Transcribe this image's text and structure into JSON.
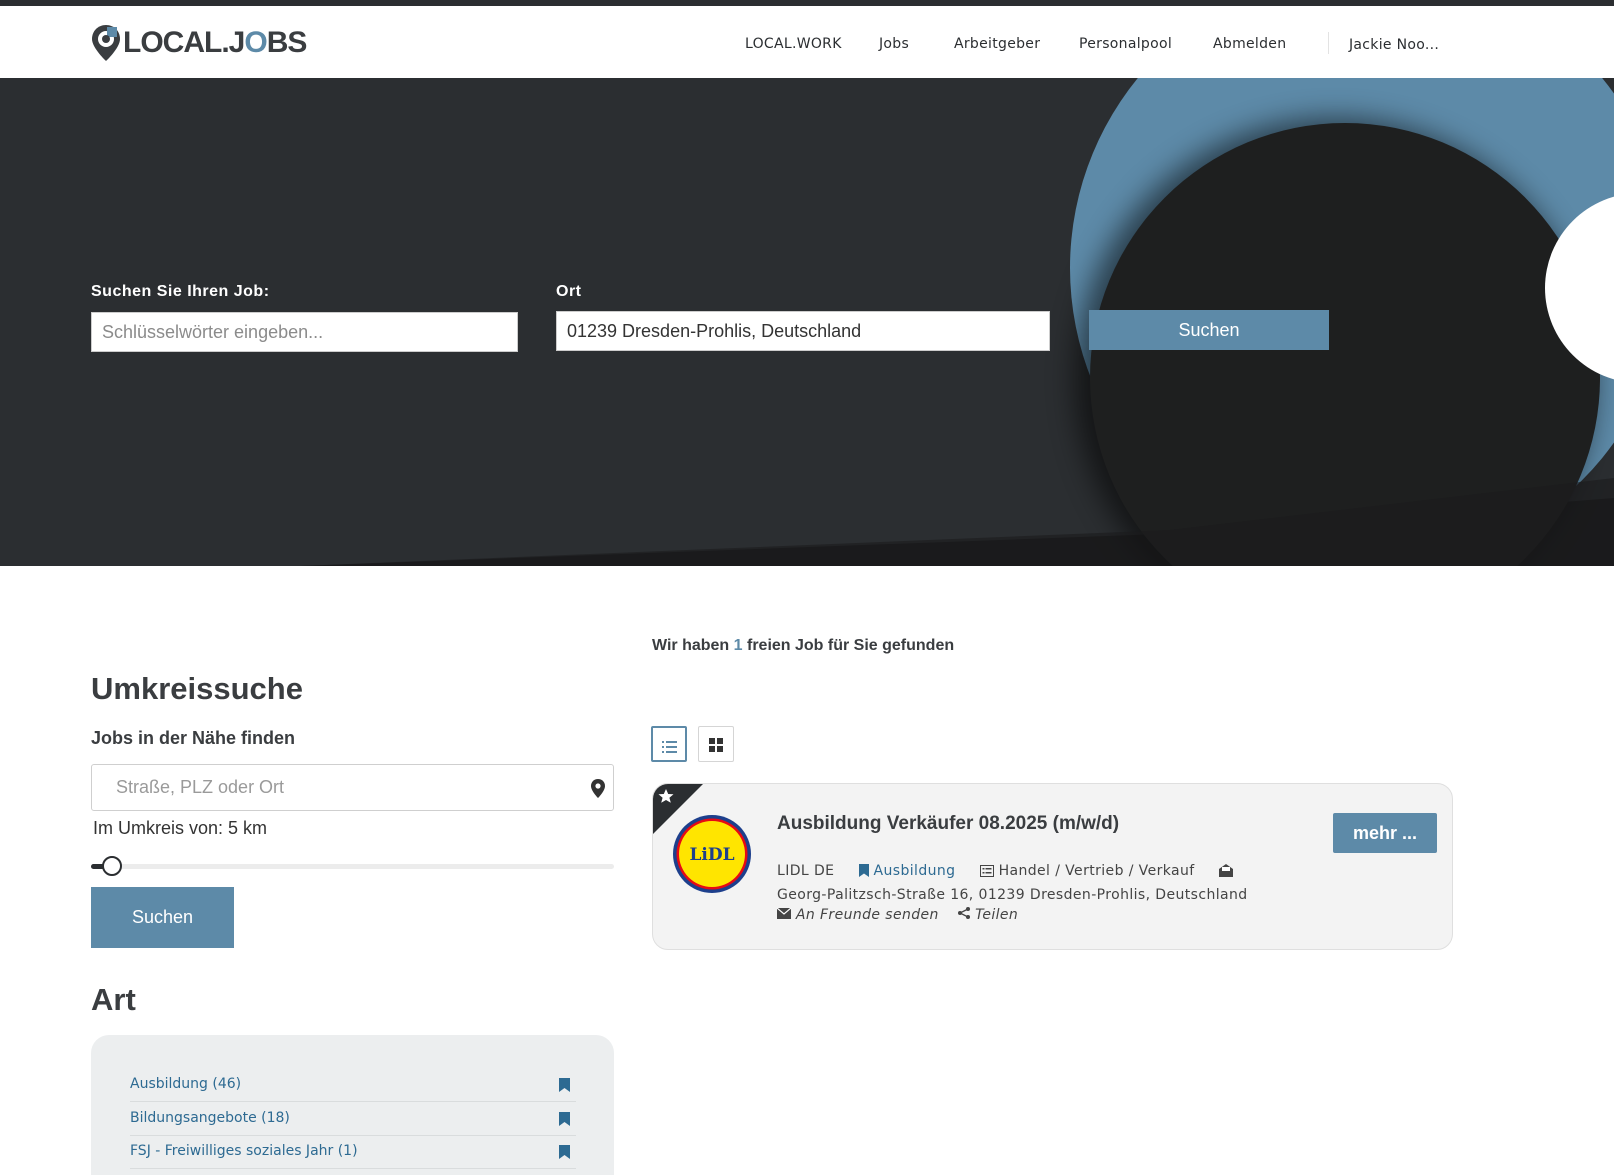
{
  "brand": {
    "logo_text": "LOCAL.JOBS",
    "accent": "#5d8aa8",
    "dark": "#2b2e31"
  },
  "nav": {
    "items": [
      "LOCAL.WORK",
      "Jobs",
      "Arbeitgeber",
      "Personalpool",
      "Abmelden"
    ],
    "user": "Jackie Noo..."
  },
  "hero": {
    "job_label": "Suchen Sie Ihren Job:",
    "job_placeholder": "Schlüsselwörter eingeben...",
    "location_label": "Ort",
    "location_value": "01239 Dresden-Prohlis, Deutschland",
    "search_button": "Suchen"
  },
  "sidebar": {
    "radius_heading": "Umkreissuche",
    "radius_subheading": "Jobs in der Nähe finden",
    "radius_placeholder": "Straße, PLZ oder Ort",
    "radius_label": "Im Umkreis von: 5 km",
    "radius_button": "Suchen",
    "type_heading": "Art",
    "type_items": [
      "Ausbildung  (46)",
      "Bildungsangebote  (18)",
      "FSJ - Freiwilliges soziales Jahr  (1)"
    ]
  },
  "results": {
    "prefix": "Wir haben ",
    "count": "1",
    "suffix": " freien Job für Sie gefunden"
  },
  "job": {
    "title": "Ausbildung Verkäufer 08.2025 (m/w/d)",
    "company": "LIDL DE",
    "type": "Ausbildung",
    "category": "Handel / Vertrieb / Verkauf",
    "address": "Georg-Palitzsch-Straße 16, 01239 Dresden-Prohlis, Deutschland",
    "send_label": "An Freunde senden",
    "share_label": "Teilen",
    "more_button": "mehr ...",
    "logo_text": "LiDL"
  }
}
